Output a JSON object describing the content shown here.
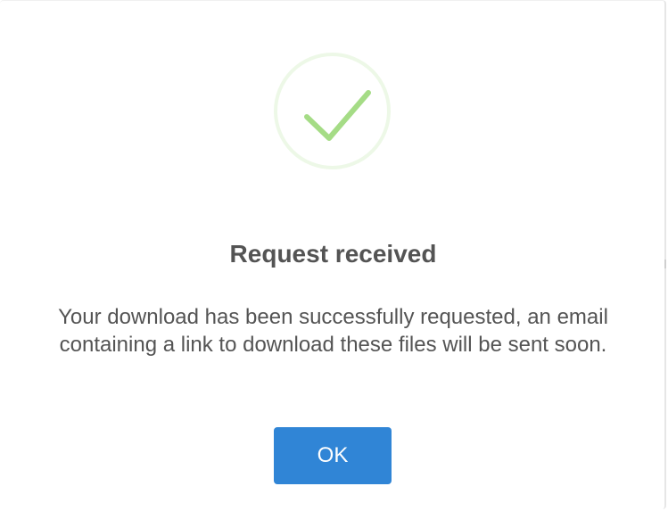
{
  "dialog": {
    "icon": "success-check-icon",
    "icon_color": "#a5dc86",
    "title": "Request received",
    "message": "Your download has been successfully requested, an email containing a link to download these files will be sent soon.",
    "ok_label": "OK",
    "button_color": "#3085d6"
  }
}
